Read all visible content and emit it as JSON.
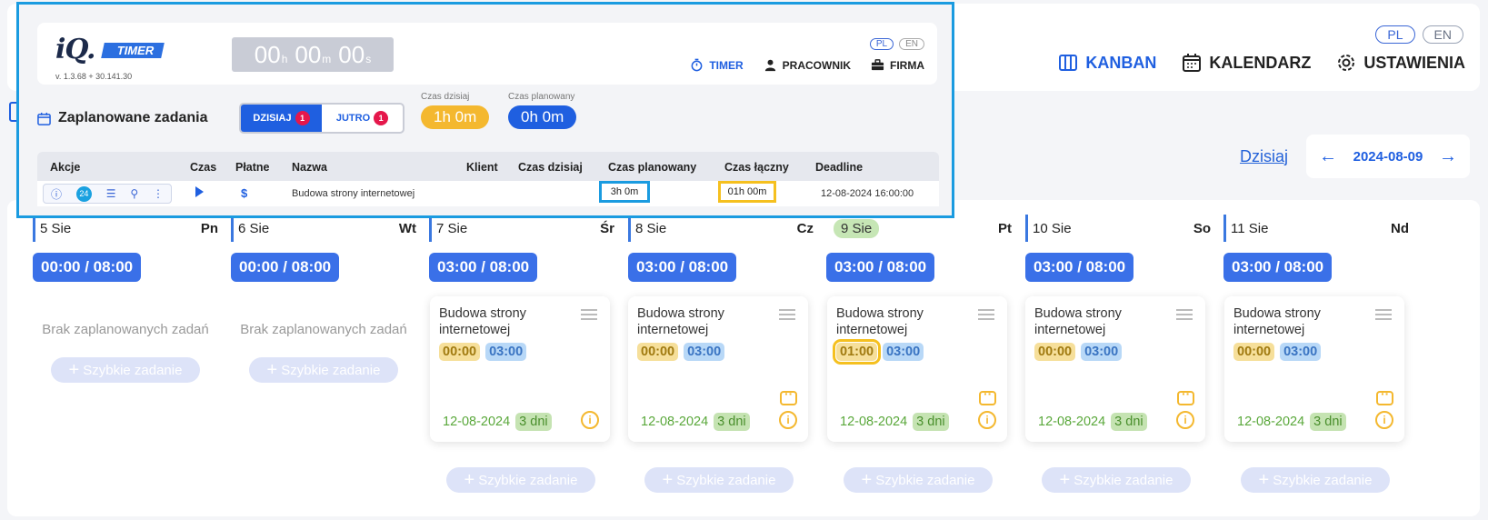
{
  "app": {
    "lang": [
      "PL",
      "EN"
    ],
    "nav": [
      {
        "label": "KANBAN",
        "icon": "kanban-icon"
      },
      {
        "label": "KALENDARZ",
        "icon": "calendar-icon"
      },
      {
        "label": "USTAWIENIA",
        "icon": "gear-icon"
      }
    ],
    "today_label": "Dzisiaj",
    "current_date": "2024-08-09",
    "accent": "#1f5fe0"
  },
  "widget": {
    "logo_text": "iQ.",
    "logo_badge": "TIMER",
    "version": "v. 1.3.68 + 30.141.30",
    "clock": {
      "h": "00",
      "h_unit": "h",
      "m": "00",
      "m_unit": "m",
      "s": "00",
      "s_unit": "s"
    },
    "lang": [
      "PL",
      "EN"
    ],
    "nav": [
      {
        "label": "TIMER",
        "icon": "stopwatch-icon"
      },
      {
        "label": "PRACOWNIK",
        "icon": "person-icon"
      },
      {
        "label": "FIRMA",
        "icon": "briefcase-icon"
      }
    ],
    "section_title": "Zaplanowane zadania",
    "toggle": {
      "today": "DZISIAJ",
      "today_count": "1",
      "tomorrow": "JUTRO",
      "tomorrow_count": "1"
    },
    "time_today": {
      "label": "Czas dzisiaj",
      "value": "1h 0m"
    },
    "time_planned": {
      "label": "Czas planowany",
      "value": "0h 0m"
    },
    "table": {
      "headers": [
        "Akcje",
        "Czas",
        "Płatne",
        "Nazwa",
        "Klient",
        "Czas dzisiaj",
        "Czas planowany",
        "Czas łączny",
        "Deadline"
      ],
      "row": {
        "action_count": "24",
        "name": "Budowa strony internetowej",
        "client": "",
        "time_today": "",
        "planned": "3h 0m",
        "total": "01h 00m",
        "deadline": "12-08-2024 16:00:00"
      }
    }
  },
  "board": {
    "days": [
      {
        "num": "5 Sie",
        "name": "Pn",
        "time": "00:00 / 08:00",
        "empty": "Brak zaplanowanych zadań",
        "quick": "Szybkie zadanie"
      },
      {
        "num": "6 Sie",
        "name": "Wt",
        "time": "00:00 / 08:00",
        "empty": "Brak zaplanowanych zadań",
        "quick": "Szybkie zadanie"
      },
      {
        "num": "7 Sie",
        "name": "Śr",
        "time": "03:00 / 08:00",
        "task": {
          "name": "Budowa strony internetowej",
          "actual": "00:00",
          "planned": "03:00",
          "deadline": "12-08-2024",
          "days": "3 dni"
        },
        "quick": "Szybkie zadanie"
      },
      {
        "num": "8 Sie",
        "name": "Cz",
        "time": "03:00 / 08:00",
        "task": {
          "name": "Budowa strony internetowej",
          "actual": "00:00",
          "planned": "03:00",
          "deadline": "12-08-2024",
          "days": "3 dni"
        },
        "quick": "Szybkie zadanie"
      },
      {
        "num": "9 Sie",
        "name": "Pt",
        "time": "03:00 / 08:00",
        "task": {
          "name": "Budowa strony internetowej",
          "actual": "01:00",
          "planned": "03:00",
          "deadline": "12-08-2024",
          "days": "3 dni"
        },
        "quick": "Szybkie zadanie"
      },
      {
        "num": "10 Sie",
        "name": "So",
        "time": "03:00 / 08:00",
        "task": {
          "name": "Budowa strony internetowej",
          "actual": "00:00",
          "planned": "03:00",
          "deadline": "12-08-2024",
          "days": "3 dni"
        },
        "quick": "Szybkie zadanie"
      },
      {
        "num": "11 Sie",
        "name": "Nd",
        "time": "03:00 / 08:00",
        "task": {
          "name": "Budowa strony internetowej",
          "actual": "00:00",
          "planned": "03:00",
          "deadline": "12-08-2024",
          "days": "3 dni"
        },
        "quick": "Szybkie zadanie"
      }
    ]
  }
}
